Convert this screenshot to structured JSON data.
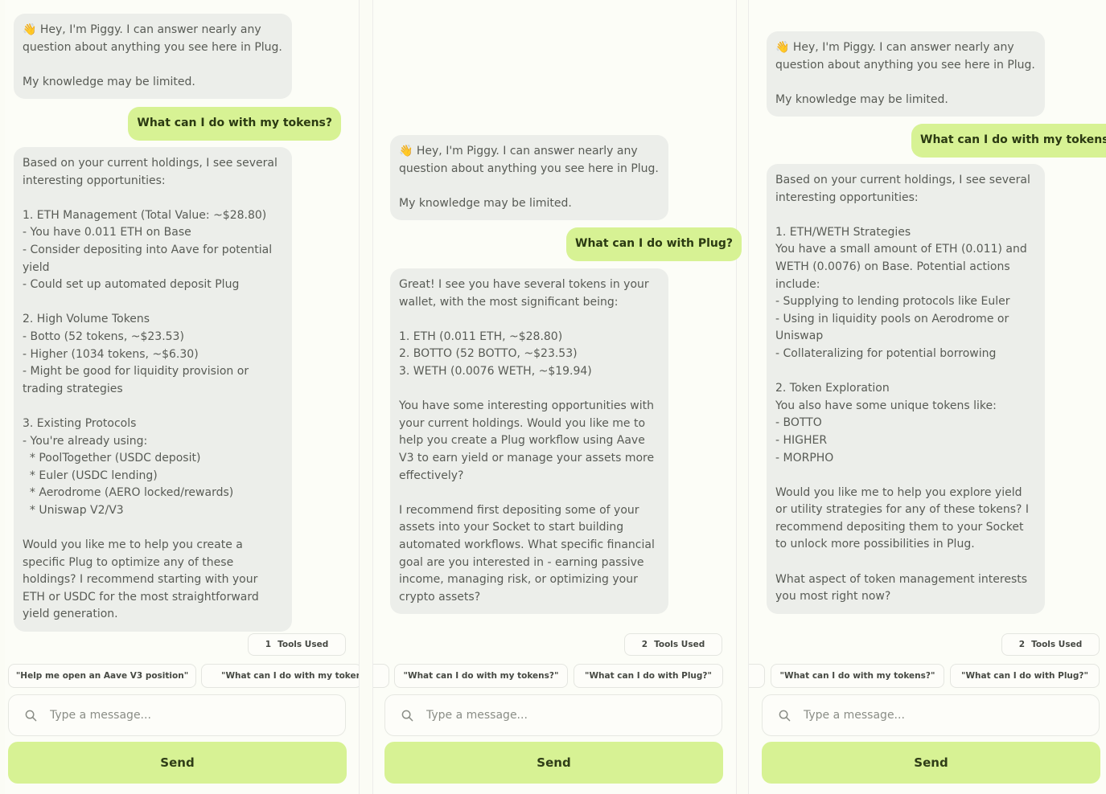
{
  "colors": {
    "accent": "#d7f294",
    "bot_bubble": "#eceeea",
    "background": "#fcfdf7"
  },
  "panels": [
    {
      "greeting": "👋 Hey, I'm Piggy. I can answer nearly any question about anything you see here in Plug.\n\nMy knowledge may be limited.",
      "user_message": "What can I do with my tokens?",
      "response": "Based on your current holdings, I see several interesting opportunities:\n\n1. ETH Management (Total Value: ~$28.80)\n- You have 0.011 ETH on Base\n- Consider depositing into Aave for potential yield\n- Could set up automated deposit Plug\n\n2. High Volume Tokens\n- Botto (52 tokens, ~$23.53)\n- Higher (1034 tokens, ~$6.30)\n- Might be good for liquidity provision or trading strategies\n\n3. Existing Protocols\n- You're already using:\n  * PoolTogether (USDC deposit)\n  * Euler (USDC lending)\n  * Aerodrome (AERO locked/rewards)\n  * Uniswap V2/V3\n\nWould you like me to help you create a specific Plug to optimize any of these holdings? I recommend starting with your ETH or USDC for the most straightforward yield generation.",
      "tools_count": "1",
      "tools_label": "Tools Used",
      "suggestions": [
        "\"Help me open an Aave V3 position\"",
        "\"What can I do with my tokens"
      ],
      "input_placeholder": "Type a message...",
      "send_label": "Send"
    },
    {
      "greeting": "👋 Hey, I'm Piggy. I can answer nearly any question about anything you see here in Plug.\n\nMy knowledge may be limited.",
      "user_message": "What can I do with Plug?",
      "response": "Great! I see you have several tokens in your wallet, with the most significant being:\n\n1. ETH (0.011 ETH, ~$28.80)\n2. BOTTO (52 BOTTO, ~$23.53)\n3. WETH (0.0076 WETH, ~$19.94)\n\nYou have some interesting opportunities with your current holdings. Would you like me to help you create a Plug workflow using Aave V3 to earn yield or manage your assets more effectively?\n\nI recommend first depositing some of your assets into your Socket to start building automated workflows. What specific financial goal are you interested in - earning passive income, managing risk, or optimizing your crypto assets?",
      "tools_count": "2",
      "tools_label": "Tools Used",
      "suggestions": [
        "\"What can I do with my tokens?\"",
        "\"What can I do with Plug?\""
      ],
      "input_placeholder": "Type a message...",
      "send_label": "Send"
    },
    {
      "greeting": "👋 Hey, I'm Piggy. I can answer nearly any question about anything you see here in Plug.\n\nMy knowledge may be limited.",
      "user_message": "What can I do with my tokens?",
      "response": "Based on your current holdings, I see several interesting opportunities:\n\n1. ETH/WETH Strategies\nYou have a small amount of ETH (0.011) and WETH (0.0076) on Base. Potential actions include:\n- Supplying to lending protocols like Euler\n- Using in liquidity pools on Aerodrome or Uniswap\n- Collateralizing for potential borrowing\n\n2. Token Exploration\nYou also have some unique tokens like:\n- BOTTO\n- HIGHER\n- MORPHO\n\nWould you like me to help you explore yield or utility strategies for any of these tokens? I recommend depositing them to your Socket to unlock more possibilities in Plug.\n\nWhat aspect of token management interests you most right now?",
      "tools_count": "2",
      "tools_label": "Tools Used",
      "suggestions": [
        "\"What can I do with my tokens?\"",
        "\"What can I do with Plug?\""
      ],
      "input_placeholder": "Type a message...",
      "send_label": "Send"
    }
  ]
}
